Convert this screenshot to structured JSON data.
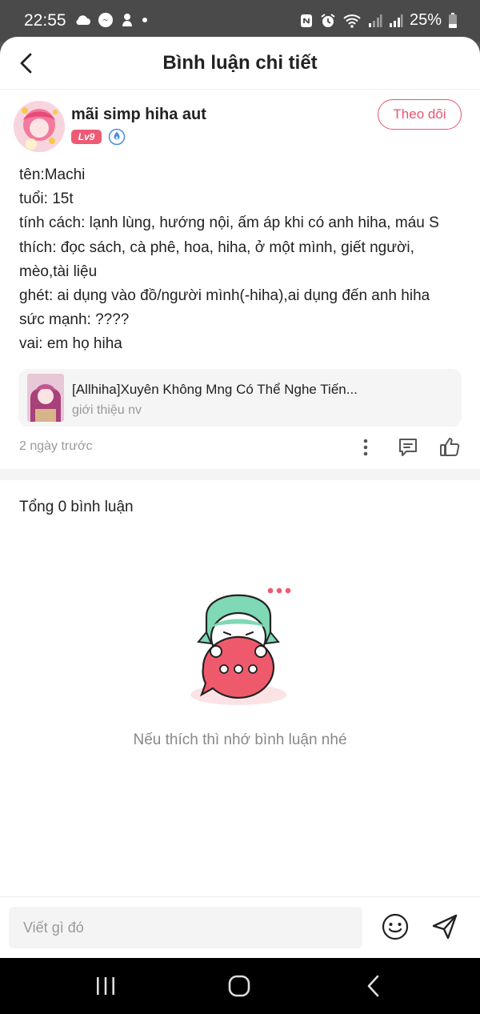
{
  "status_bar": {
    "time": "22:55",
    "battery": "25%",
    "left_icons": [
      "cloud-icon",
      "messenger-icon",
      "notification-icon",
      "dot-icon"
    ],
    "right_icons": [
      "nfc-icon",
      "alarm-icon",
      "wifi-icon",
      "signal-icon",
      "signal-icon",
      "battery-icon"
    ]
  },
  "header": {
    "title": "Bình luận chi tiết"
  },
  "author": {
    "name": "mãi simp hiha aut",
    "level": "Lv9",
    "follow_label": "Theo dõi"
  },
  "post": {
    "lines": [
      "tên:Machi",
      "tuổi: 15t",
      "tính cách: lạnh lùng, hướng nội, ấm áp khi có anh hiha, máu S",
      "thích: đọc sách, cà phê, hoa, hiha, ở một mình, giết người,",
      "mèo,tài liệu",
      "ghét: ai dụng vào đồ/người mình(-hiha),ai dụng đến anh hiha",
      "sức mạnh: ????",
      "vai: em họ hiha"
    ],
    "linked": {
      "title": "[Allhiha]Xuyên Không Mng Có Thể Nghe Tiến...",
      "subtitle": "giới thiệu nv"
    },
    "time_ago": "2 ngày trước"
  },
  "comments": {
    "total_label": "Tổng 0 bình luận",
    "empty_text": "Nếu thích thì nhớ bình luận nhé"
  },
  "input": {
    "placeholder": "Viết gì đó"
  },
  "colors": {
    "accent": "#e8566e",
    "level_badge": "#ee5a73",
    "muted_text": "#999999"
  }
}
